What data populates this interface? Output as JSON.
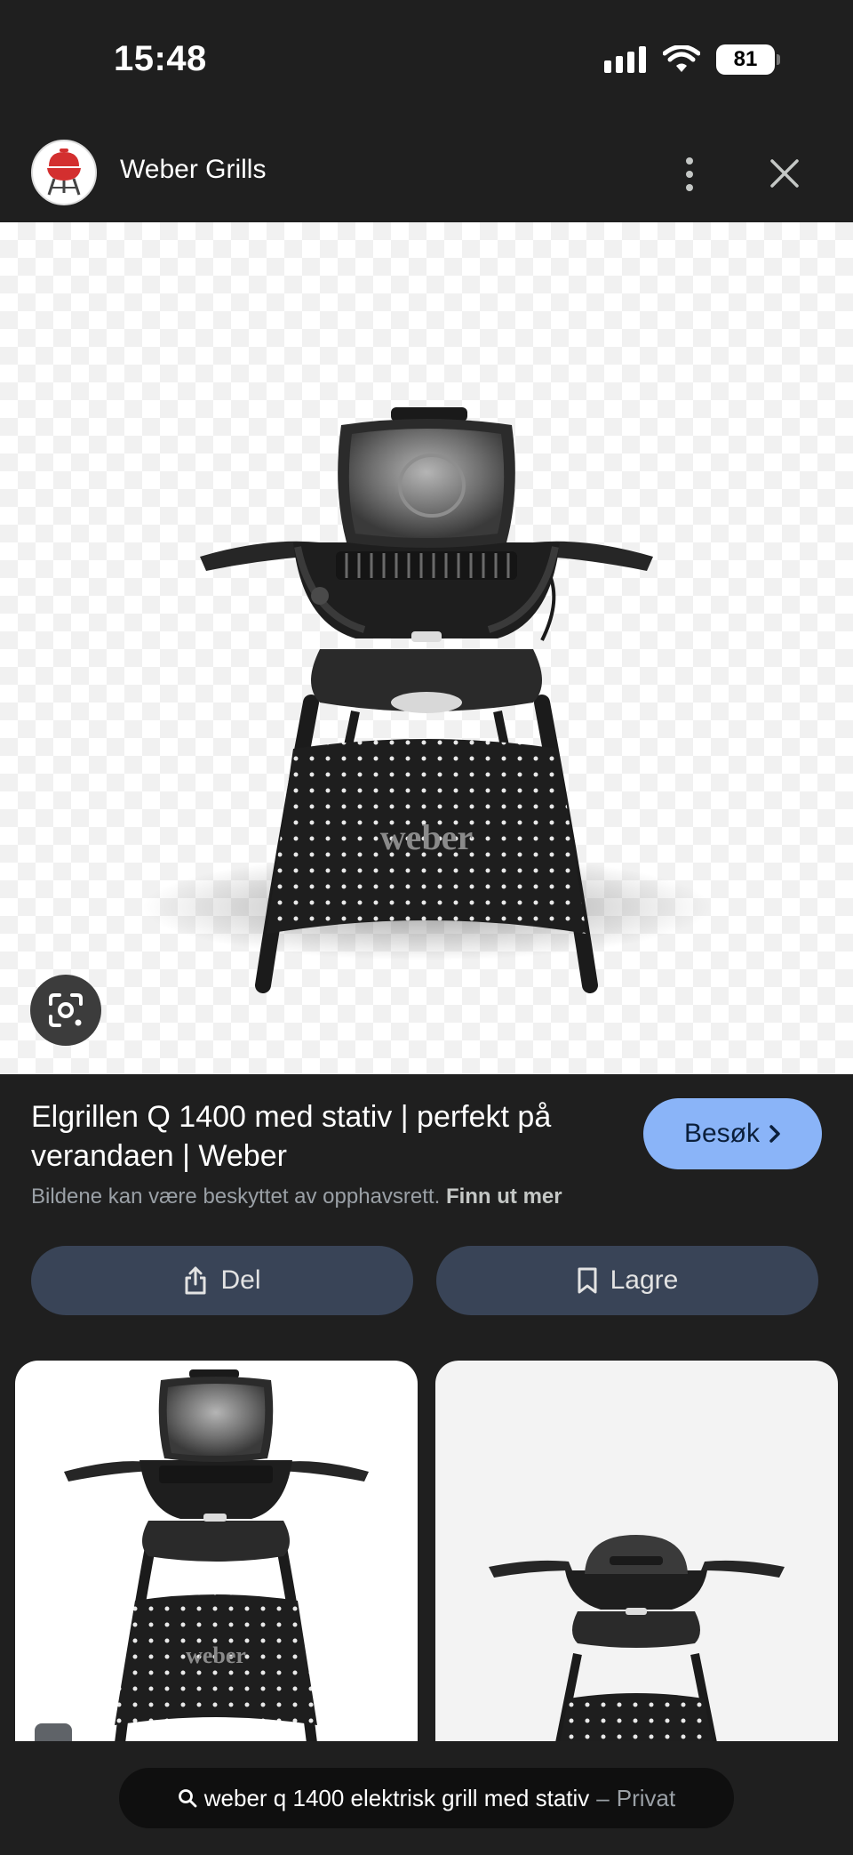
{
  "status_bar": {
    "time": "15:48",
    "battery": "81"
  },
  "header": {
    "site_name": "Weber Grills",
    "icons": [
      "weber-logo-icon",
      "more-vert-icon",
      "close-icon"
    ]
  },
  "hero": {
    "brand_text": "weber",
    "lens_icon": "google-lens-icon"
  },
  "result": {
    "title": "Elgrillen Q 1400 med stativ | perfekt på verandaen | Weber",
    "visit_label": "Besøk",
    "copyright_text": "Bildene kan være beskyttet av opphavsrett.",
    "learn_more": "Finn ut mer",
    "accent": "#8ab4f8"
  },
  "actions": {
    "share_label": "Del",
    "save_label": "Lagre"
  },
  "bottom": {
    "query": "weber q 1400 elektrisk grill med stativ",
    "separator": "–",
    "mode": "Privat"
  }
}
